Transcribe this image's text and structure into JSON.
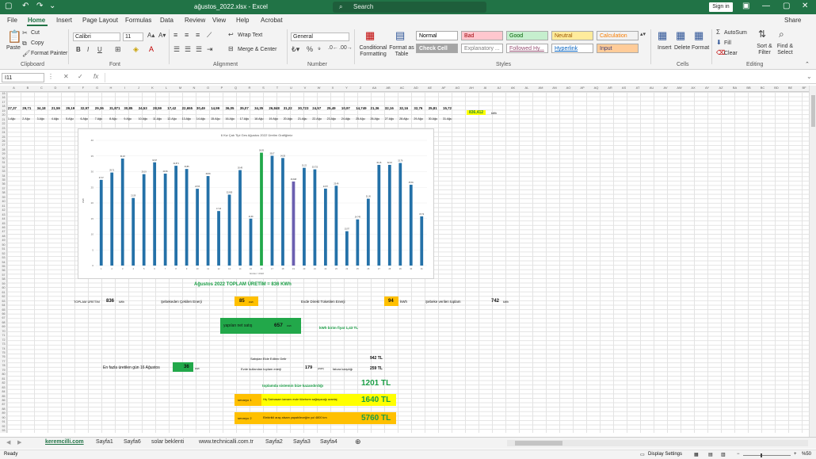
{
  "window": {
    "title": "ağustos_2022.xlsx  -  Excel",
    "search_placeholder": "Search",
    "signin": "Sign in",
    "autosave_icon": "autosave-icon"
  },
  "tabs": [
    "File",
    "Home",
    "Insert",
    "Page Layout",
    "Formulas",
    "Data",
    "Review",
    "View",
    "Help",
    "Acrobat"
  ],
  "share": "Share",
  "ribbon": {
    "clipboard": {
      "paste": "Paste",
      "cut": "Cut",
      "copy": "Copy",
      "format_painter": "Format Painter",
      "label": "Clipboard"
    },
    "font": {
      "name": "Calibri",
      "size": "11",
      "label": "Font"
    },
    "alignment": {
      "wrap": "Wrap Text",
      "merge": "Merge & Center",
      "label": "Alignment"
    },
    "number": {
      "format": "General",
      "label": "Number"
    },
    "styles": {
      "cond": "Conditional Formatting",
      "fmt_table": "Format as Table",
      "label": "Styles",
      "boxes": [
        {
          "t": "Normal",
          "bg": "#ffffff",
          "fg": "#000000"
        },
        {
          "t": "Bad",
          "bg": "#ffc7ce",
          "fg": "#9c0006"
        },
        {
          "t": "Good",
          "bg": "#c6efce",
          "fg": "#006100"
        },
        {
          "t": "Neutral",
          "bg": "#ffeb9c",
          "fg": "#9c5700"
        },
        {
          "t": "Calculation",
          "bg": "#f2f2f2",
          "fg": "#fa7d00"
        },
        {
          "t": "Check Cell",
          "bg": "#a5a5a5",
          "fg": "#ffffff"
        },
        {
          "t": "Explanatory ...",
          "bg": "#ffffff",
          "fg": "#7f7f7f"
        },
        {
          "t": "Followed Hy...",
          "bg": "#ffffff",
          "fg": "#954f72"
        },
        {
          "t": "Hyperlink",
          "bg": "#ffffff",
          "fg": "#0563c1"
        },
        {
          "t": "Input",
          "bg": "#ffcc99",
          "fg": "#3f3f76"
        }
      ]
    },
    "cells": {
      "insert": "Insert",
      "delete": "Delete",
      "format": "Format",
      "label": "Cells"
    },
    "editing": {
      "autosum": "AutoSum",
      "fill": "Fill",
      "clear": "Clear",
      "sort": "Sort & Filter",
      "find": "Find & Select",
      "label": "Editing"
    }
  },
  "formula": {
    "namebox": "I11",
    "fx": "fx"
  },
  "columns": [
    "A",
    "B",
    "C",
    "D",
    "E",
    "F",
    "G",
    "H",
    "I",
    "J",
    "K",
    "L",
    "M",
    "N",
    "O",
    "P",
    "Q",
    "R",
    "S",
    "T",
    "U",
    "V",
    "W",
    "X",
    "Y",
    "Z",
    "AA",
    "AB",
    "AC",
    "AD",
    "AE",
    "AF",
    "AG",
    "AH",
    "AI",
    "AJ",
    "AK",
    "AL",
    "AM",
    "AN",
    "AO",
    "AP",
    "AQ",
    "AR",
    "AS",
    "AT",
    "AU",
    "AV",
    "AW",
    "AX",
    "AY",
    "AZ",
    "BA",
    "BB",
    "BC",
    "BD",
    "BE",
    "BF"
  ],
  "row_numbers": [
    "15",
    "16",
    "17",
    "18",
    "19",
    "20",
    "21",
    "22",
    "23",
    "24",
    "25",
    "26",
    "27",
    "28",
    "29",
    "30",
    "31",
    "32",
    "33",
    "34",
    "35",
    "36",
    "37",
    "38",
    "39",
    "40",
    "41",
    "42",
    "43",
    "44",
    "45",
    "46",
    "47",
    "48",
    "49",
    "50",
    "51",
    "52",
    "53",
    "54",
    "55",
    "56",
    "57",
    "58",
    "59",
    "60",
    "61",
    "62",
    "63",
    "64",
    "65",
    "66",
    "67",
    "68",
    "69",
    "70",
    "71",
    "72",
    "73",
    "74",
    "75",
    "76",
    "77",
    "78",
    "79",
    "80",
    "81",
    "82",
    "83",
    "84",
    "85",
    "86",
    "87",
    "88",
    "89",
    "90",
    "91",
    "92",
    "93"
  ],
  "daily": {
    "values": [
      "27,37",
      "29,71",
      "34,18",
      "21,59",
      "29,19",
      "32,97",
      "29,36",
      "31,871",
      "30,85",
      "24,53",
      "28,59",
      "17,42",
      "22,655",
      "30,49",
      "14,99",
      "36,05",
      "35,07",
      "34,35",
      "26,848",
      "31,22",
      "30,723",
      "24,57",
      "25,49",
      "10,97",
      "14,749",
      "21,36",
      "32,16",
      "32,16",
      "32,76",
      "25,81",
      "15,72"
    ],
    "dates": [
      "1.Ağu",
      "2.Ağu",
      "3.Ağu",
      "4.Ağu",
      "5.Ağu",
      "6.Ağu",
      "7.Ağu",
      "8.Ağu",
      "9.Ağu",
      "10.Ağu",
      "11.Ağu",
      "12.Ağu",
      "13.Ağu",
      "14.Ağu",
      "15.Ağu",
      "16.Ağu",
      "17.Ağu",
      "18.Ağu",
      "19.Ağu",
      "20.Ağu",
      "21.Ağu",
      "22.Ağu",
      "23.Ağu",
      "24.Ağu",
      "25.Ağu",
      "26.Ağu",
      "27.Ağu",
      "28.Ağu",
      "29.Ağu",
      "30.Ağu",
      "31.Ağu"
    ],
    "total": "836,412",
    "total_unit": "kWh"
  },
  "chart_data": {
    "type": "bar",
    "title": "6 Kw Çatı Tipi Ges Ağustos 2022 Üretim Grafiğimiz",
    "xlabel": "Günler / 2022",
    "ylabel": "kWh",
    "categories": [
      "1",
      "2",
      "3",
      "4",
      "5",
      "6",
      "7",
      "8",
      "9",
      "10",
      "11",
      "12",
      "13",
      "14",
      "15",
      "16",
      "17",
      "18",
      "19",
      "20",
      "21",
      "22",
      "23",
      "24",
      "25",
      "26",
      "27",
      "28",
      "29",
      "30",
      "31"
    ],
    "values": [
      27.37,
      29.71,
      34.18,
      21.59,
      29.19,
      32.97,
      29.36,
      31.871,
      30.85,
      24.53,
      28.59,
      17.42,
      22.655,
      30.49,
      14.99,
      36.05,
      35.07,
      34.35,
      26.848,
      31.22,
      30.723,
      24.57,
      25.49,
      10.97,
      14.749,
      21.36,
      32.16,
      32.16,
      32.76,
      25.81,
      15.72
    ],
    "ylim": [
      0,
      40
    ],
    "yticks": [
      "0",
      "5",
      "10",
      "15",
      "20",
      "25",
      "30",
      "35",
      "40"
    ],
    "colors": {
      "default": "#2471a8",
      "highlight": "#22a84a",
      "alt": "#6b5fb0"
    },
    "highlight_index": 15,
    "alt_index": 18
  },
  "summary": {
    "headline": "Ağustos 2022 TOPLAM ÜRETİM = 836 KWh",
    "toplam_label": "TOPLAM ÜRETİM",
    "toplam_val": "836",
    "toplam_unit": "kWh",
    "sebeke_cekilen_label": "Şebekeden Çekilen Enerji",
    "sebeke_cekilen_val": "85",
    "sebeke_cekilen_unit": "kWh",
    "evde_label": "Evde Direkt Tüketilen Enerji",
    "evde_val": "94",
    "evde_unit": "kWh",
    "verilen_label": "Şebeke verilen toplam",
    "verilen_val": "742",
    "verilen_unit": "kWh",
    "net_label": "yapılan net satış",
    "net_val": "657",
    "net_unit": "kWh",
    "fiyat": "kWh birim fiyat 1,43 TL",
    "max_label": "En fazla üretilen gün 16 Ağustos",
    "max_val": "36",
    "max_unit": "kWh",
    "gelir_label": "Satıştan Elde Edilen Gelir",
    "gelir_val": "942 TL",
    "kullanilan_label": "Evde kullanılan toplam enerji",
    "kullanilan_val": "179",
    "kullanilan_unit": "(kWh)",
    "fatura_label": "fatura karşılığı",
    "fatura_val": "259 TL",
    "kazanc_label": "toplamda sistemin bize kazandırdığı",
    "kazanc_val": "1201 TL",
    "s1_label": "senaryo 1",
    "s1_desc": "Hiç Satmasam tamamı evde tüketsem sağlayacağı avantaj",
    "s1_val": "1640 TL",
    "s2_label": "senaryo 2",
    "s2_desc": "Elektrikli araç alsam yapabileceğim yol   4800 km",
    "s2_val": "5760 TL"
  },
  "sheets": [
    "keremcilli.com",
    "Sayfa1",
    "Sayfa6",
    "solar beklenti",
    "www.technicalli.com.tr",
    "Sayfa2",
    "Sayfa3",
    "Sayfa4"
  ],
  "status": {
    "ready": "Ready",
    "display": "Display Settings",
    "zoom": "%50"
  }
}
